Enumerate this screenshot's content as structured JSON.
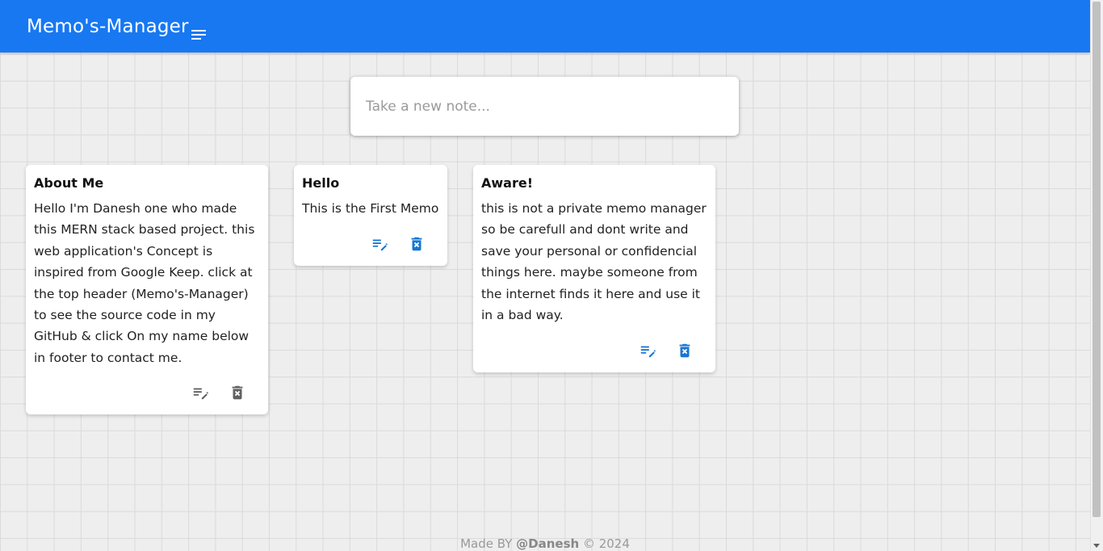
{
  "header": {
    "brand": "Memo's-Manager",
    "menu_icon": "menu-lines-icon",
    "color": "#1778f2"
  },
  "composer": {
    "placeholder": "Take a new note..."
  },
  "notes": [
    {
      "title": "About Me",
      "content": "Hello I'm Danesh one who made this MERN stack based project. this web application's Concept is inspired from Google Keep. click at the top header (Memo's-Manager) to see the source code in my GitHub & click On my name below in footer to contact me.",
      "edit_icon": "edit-note-icon",
      "delete_icon": "delete-forever-icon"
    },
    {
      "title": "Hello",
      "content": "This is the First Memo",
      "edit_icon": "edit-note-icon",
      "delete_icon": "delete-forever-icon"
    },
    {
      "title": "Aware!",
      "content": "this is not a private memo manager so be carefull and dont write and save your personal or confidencial things here. maybe someone from the internet finds it here and use it in a bad way.",
      "edit_icon": "edit-note-icon",
      "delete_icon": "delete-forever-icon"
    }
  ],
  "footer": {
    "prefix": "Made BY ",
    "author": "@Danesh",
    "suffix": " © 2024"
  },
  "colors": {
    "accent": "#1778f2",
    "icon": "#1976d2"
  }
}
